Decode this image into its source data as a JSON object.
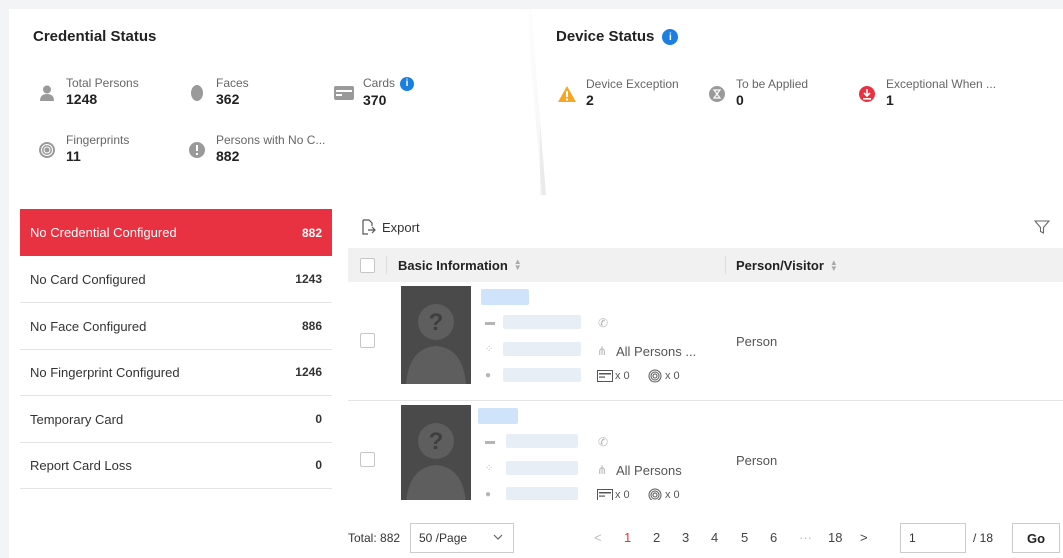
{
  "credential_status": {
    "title": "Credential Status",
    "stats": [
      {
        "label": "Total Persons",
        "value": "1248",
        "icon": "person-icon"
      },
      {
        "label": "Faces",
        "value": "362",
        "icon": "face-icon"
      },
      {
        "label": "Cards",
        "value": "370",
        "icon": "card-icon"
      },
      {
        "label": "Fingerprints",
        "value": "11",
        "icon": "fingerprint-icon"
      },
      {
        "label": "Persons with No C...",
        "value": "882",
        "icon": "no-credential-icon"
      }
    ]
  },
  "device_status": {
    "title": "Device Status",
    "stats": [
      {
        "label": "Device Exception",
        "value": "2",
        "icon": "warning-icon",
        "color": "#f5a623"
      },
      {
        "label": "To be Applied",
        "value": "0",
        "icon": "hourglass-icon",
        "color": "#9a9a9a"
      },
      {
        "label": "Exceptional When ...",
        "value": "1",
        "icon": "download-error-icon",
        "color": "#e83241"
      }
    ]
  },
  "categories": [
    {
      "label": "No Credential Configured",
      "count": "882",
      "active": true
    },
    {
      "label": "No Card Configured",
      "count": "1243"
    },
    {
      "label": "No Face Configured",
      "count": "886"
    },
    {
      "label": "No Fingerprint Configured",
      "count": "1246"
    },
    {
      "label": "Temporary Card",
      "count": "0"
    },
    {
      "label": "Report Card Loss",
      "count": "0"
    }
  ],
  "toolbar": {
    "export_label": "Export"
  },
  "table": {
    "columns": [
      "Basic Information",
      "Person/Visitor"
    ],
    "rows": [
      {
        "group": "All Persons ...",
        "card_count": "x 0",
        "fingerprint_count": "x 0",
        "type": "Person"
      },
      {
        "group": "All Persons",
        "card_count": "x 0",
        "fingerprint_count": "x 0",
        "type": "Person"
      }
    ]
  },
  "pagination": {
    "total": "Total: 882",
    "page_size": "50 /Page",
    "pages": [
      "1",
      "2",
      "3",
      "4",
      "5",
      "6",
      "···",
      "18"
    ],
    "current": "1",
    "goto_value": "1",
    "total_pages": "/ 18",
    "go_label": "Go"
  },
  "colors": {
    "accent": "#e83241",
    "info": "#1a7fe0"
  }
}
